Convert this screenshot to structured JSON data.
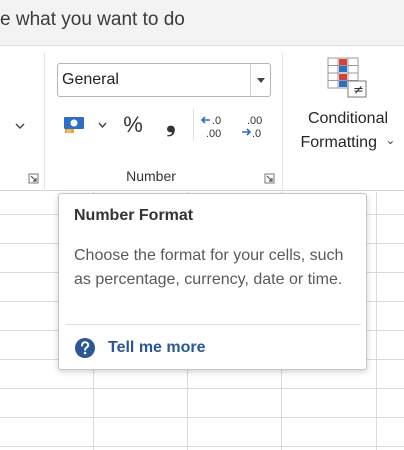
{
  "tell_me": {
    "text": "e what you want to do"
  },
  "number_group": {
    "format_value": "General",
    "percent_label": "%",
    "comma_label": "❟",
    "group_label": "Number"
  },
  "conditional_formatting": {
    "label_line1": "Conditional",
    "label_line2": "Formatting",
    "chevron": "⌄"
  },
  "tooltip": {
    "title": "Number Format",
    "description": "Choose the format for your cells, such as percentage, currency, date or time.",
    "link_text": "Tell me more"
  },
  "colors": {
    "tooltip_link": "#2b5796",
    "help_icon": "#2b5796",
    "accent_blue": "#2e6ec4",
    "accent_red": "#d2443a"
  },
  "icons": {
    "accounting": "accounting-format-icon",
    "increase_decimal": "increase-decimal-icon",
    "decrease_decimal": "decrease-decimal-icon",
    "conditional": "conditional-formatting-icon",
    "help": "help-icon"
  }
}
